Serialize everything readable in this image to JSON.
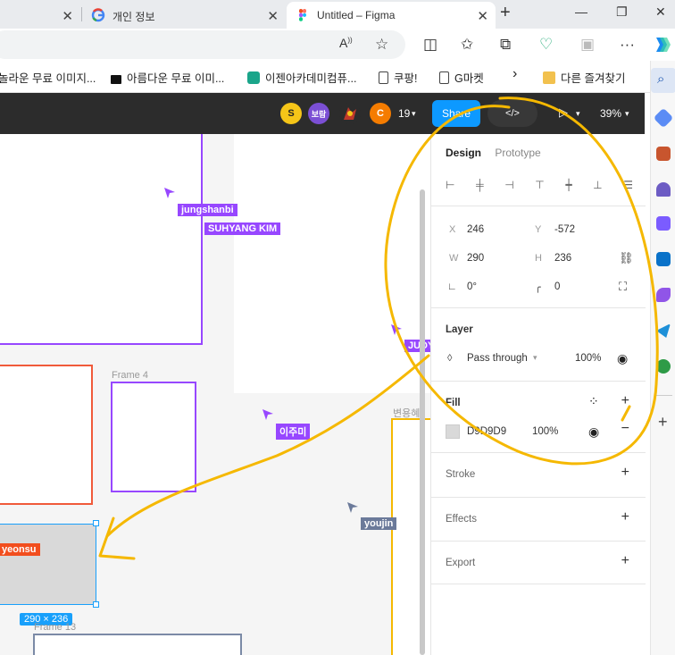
{
  "browser": {
    "tabs": [
      {
        "label": ""
      },
      {
        "label": "개인 정보"
      },
      {
        "label": "Untitled – Figma"
      }
    ],
    "bookmarks": [
      {
        "label": "놀라운 무료 이미지..."
      },
      {
        "label": "아름다운 무료 이미..."
      },
      {
        "label": "이젠아카데미컴퓨..."
      },
      {
        "label": "쿠팡!"
      },
      {
        "label": "G마켓"
      },
      {
        "label": "다른 즐겨찾기"
      }
    ],
    "colors": {
      "tabstrip": "#e9ebee",
      "accent": "#0d99ff"
    }
  },
  "toolbar": {
    "avatars": [
      {
        "initial": "S",
        "color": "#f5c518"
      },
      {
        "initial": "보람",
        "color": "#7b4fd4"
      },
      {
        "initial": "",
        "color": "#c0392b"
      },
      {
        "initial": "C",
        "color": "#f57c00"
      }
    ],
    "collab_count": "19",
    "share_label": "Share",
    "zoom": "39%"
  },
  "canvas": {
    "frame_labels": [
      "Frame 4",
      "Frame 13",
      "변용혜"
    ],
    "cursors": [
      {
        "name": "jungshanbi",
        "color": "#9747ff"
      },
      {
        "name": "SUHYANG KIM",
        "color": "#9747ff"
      },
      {
        "name": "JUDY",
        "color": "#9747ff"
      },
      {
        "name": "이주미",
        "color": "#9747ff"
      },
      {
        "name": "youjin",
        "color": "#6b7a9a"
      },
      {
        "name": "yeonsu",
        "color": "#f24e1e"
      }
    ],
    "selection_size": "290 × 236"
  },
  "panel": {
    "tabs": {
      "design": "Design",
      "prototype": "Prototype"
    },
    "position": {
      "x_label": "X",
      "x": "246",
      "y_label": "Y",
      "y": "-572"
    },
    "size": {
      "w_label": "W",
      "w": "290",
      "h_label": "H",
      "h": "236"
    },
    "rotation": "0°",
    "radius": "0",
    "layer": {
      "title": "Layer",
      "blend": "Pass through",
      "opacity": "100%"
    },
    "fill": {
      "title": "Fill",
      "hex": "D9D9D9",
      "opacity": "100%",
      "swatch": "#d9d9d9"
    },
    "stroke": {
      "title": "Stroke"
    },
    "effects": {
      "title": "Effects"
    },
    "export": {
      "title": "Export"
    }
  },
  "annotation": {
    "color": "#f5b800"
  }
}
